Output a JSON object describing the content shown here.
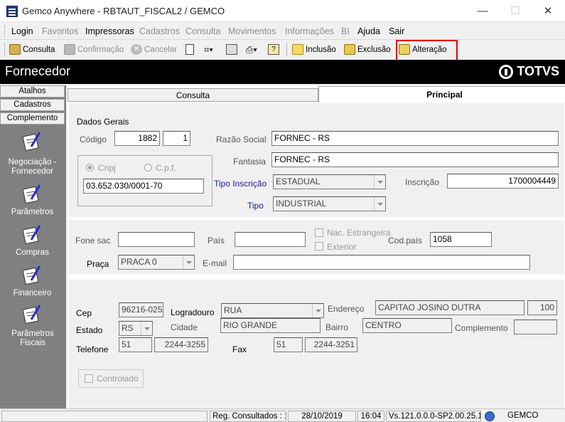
{
  "window": {
    "title": "Gemco Anywhere - RBTAUT_FISCAL2 / GEMCO",
    "minimize": "—",
    "maximize": "☐",
    "close": "✕"
  },
  "menu": [
    "Login",
    "Favoritos",
    "Impressoras",
    "Cadastros",
    "Consulta",
    "Movimentos",
    "Informações",
    "BI",
    "Ajuda",
    "Sair"
  ],
  "toolbar": {
    "consulta": "Consulta",
    "confirmacao": "Confirmação",
    "cancelar": "Cancelar",
    "inclusao": "Inclusão",
    "exclusao": "Exclusão",
    "alteracao": "Alteração"
  },
  "banner": {
    "title": "Fornecedor",
    "logo": "TOTVS"
  },
  "sidebar": {
    "tabs": [
      "Atalhos",
      "Cadastros",
      "Complemento"
    ],
    "items": [
      "Negociação - Fornecedor",
      "Parâmetros",
      "Compras",
      "Financeiro",
      "Parâmetros Fiscais"
    ]
  },
  "tabs": {
    "consulta": "Consulta",
    "principal": "Principal"
  },
  "dados_gerais": {
    "group": "Dados Gerais",
    "codigo_label": "Código",
    "codigo": "1882",
    "codigo_dig": "1",
    "razao_label": "Razão Social",
    "razao": "FORNEC - RS",
    "fantasia_label": "Fantasia",
    "fantasia": "FORNEC - RS",
    "cnpj_label": "Cnpj",
    "cpf_label": "C.p.f.",
    "cnpj": "03.652.030/0001-70",
    "tipo_insc_label": "Tipo Inscrição",
    "tipo_insc": "ESTADUAL",
    "inscricao_label": "Inscrição",
    "inscricao": "1700004449",
    "tipo_label": "Tipo",
    "tipo": "INDUSTRIAL"
  },
  "contato": {
    "fone_label": "Fone sac",
    "fone": "",
    "pais_label": "País",
    "pais": "",
    "nac_label": "Nac. Estrangeira",
    "exterior_label": "Exterior",
    "codpais_label": "Cod.país",
    "codpais": "1058",
    "praca_label": "Praça",
    "praca": "PRACA 0",
    "email_label": "E-mail",
    "email": ""
  },
  "endereco": {
    "cep_label": "Cep",
    "cep": "96216-025",
    "logradouro_label": "Logradouro",
    "logradouro": "RUA",
    "endereco_label": "Endereço",
    "endereco": "CAPITAO JOSINO DUTRA",
    "numero": "100",
    "estado_label": "Estado",
    "estado": "RS",
    "cidade_label": "Cidade",
    "cidade": "RIO GRANDE",
    "bairro_label": "Bairro",
    "bairro": "CENTRO",
    "complemento_label": "Complemento",
    "complemento": "",
    "telefone_label": "Telefone",
    "tel_ddd": "51",
    "tel": "2244-3255",
    "fax_label": "Fax",
    "fax_ddd": "51",
    "fax": "2244-3251",
    "controlado_label": "Controlado"
  },
  "status": {
    "reg": "Reg. Consultados : 1",
    "date": "28/10/2019",
    "time": "16:04",
    "version": "Vs.121.0.0.0-SP2.00.25.11",
    "db": "GEMCO"
  }
}
